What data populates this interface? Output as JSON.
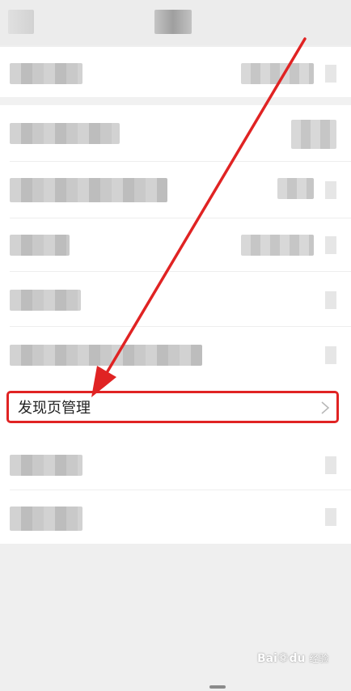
{
  "header": {
    "title": ""
  },
  "highlighted_item": {
    "label": "发现页管理"
  },
  "watermark": {
    "brand": "Bai",
    "brand_suffix": "du",
    "sub": "经验"
  },
  "colors": {
    "annotation_red": "#e02323",
    "background": "#efefef",
    "card": "#ffffff"
  },
  "icons": {
    "chevron": "chevron-right-icon",
    "paw": "baidu-paw-icon"
  }
}
